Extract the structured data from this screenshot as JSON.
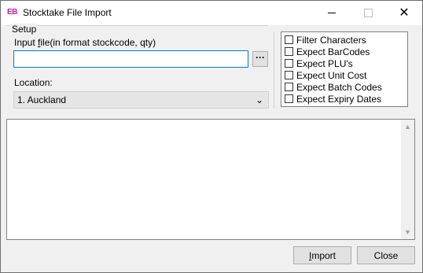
{
  "window": {
    "app_icon": "EB",
    "title": "Stocktake File Import",
    "min_icon": "minimize-icon",
    "max_icon": "maximize-icon",
    "close_icon": "close-icon",
    "close_glyph": "✕"
  },
  "setup": {
    "legend": "Setup",
    "input_label_prefix": "Input ",
    "input_label_hotkey": "f",
    "input_label_rest": "ile(in format stockcode, qty)",
    "file_value": "",
    "browse_label": "···",
    "location_label": "Location:",
    "location_value": "1. Auckland",
    "chevron": "⌄"
  },
  "options": [
    {
      "label": "Filter Characters",
      "checked": false
    },
    {
      "label": "Expect BarCodes",
      "checked": false
    },
    {
      "label": "Expect PLU's",
      "checked": false
    },
    {
      "label": "Expect Unit Cost",
      "checked": false
    },
    {
      "label": "Expect Batch Codes",
      "checked": false
    },
    {
      "label": "Expect Expiry Dates",
      "checked": false
    }
  ],
  "log": {
    "text": "",
    "up": "▲",
    "down": "▼"
  },
  "buttons": {
    "import_hotkey": "I",
    "import_rest": "mport",
    "close": "Close"
  }
}
